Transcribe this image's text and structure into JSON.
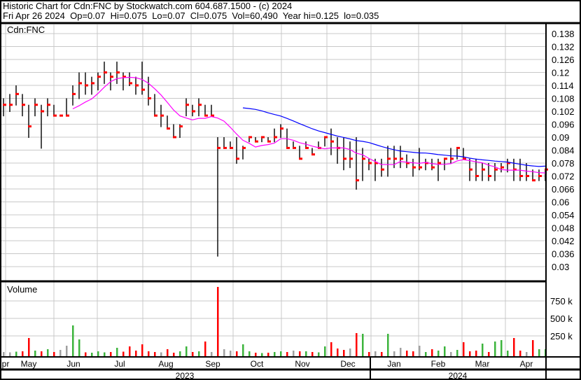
{
  "header": {
    "title": "Historic Chart for Cdn:FNC by Stockwatch.com 604.687.1500 - (c) 2024",
    "summary": "Fri Apr 26 2024  Op=0.07  Hi=0.075  Lo=0.07  Cl=0.075  Vol=60,490  Year hi=0.125  lo=0.035"
  },
  "colors": {
    "up": "#3cb43c",
    "down": "#ff0000",
    "flat": "#a0a0a0",
    "ma_short": "#ff00ff",
    "ma_long": "#0000ff",
    "tick": "#ff0000",
    "grid": "#c8c8c8"
  },
  "chart_data": {
    "type": "line",
    "title": "Cdn:FNC",
    "price_ticks": [
      "0.138",
      "0.132",
      "0.126",
      "0.12",
      "0.114",
      "0.108",
      "0.102",
      "0.096",
      "0.09",
      "0.084",
      "0.078",
      "0.072",
      "0.066",
      "0.06",
      "0.054",
      "0.048",
      "0.042",
      "0.036",
      "0.03"
    ],
    "ylim": [
      0.027,
      0.141
    ],
    "volume": {
      "label": "Volume",
      "ticks": [
        "750 k",
        "500 k",
        "250 k"
      ],
      "tick_values": [
        750,
        500,
        250
      ],
      "ylim": [
        0,
        1000
      ]
    },
    "months": [
      "pr",
      "May",
      "Jun",
      "Jul",
      "Aug",
      "Sep",
      "Oct",
      "Nov",
      "Dec",
      "Jan",
      "Feb",
      "Mar",
      "Apr"
    ],
    "years": [
      "2023",
      "2024"
    ],
    "ma_periods": [
      7,
      30
    ],
    "ma_start": [
      11,
      38
    ],
    "bars": [
      [
        0.108,
        0.1,
        0.105,
        20
      ],
      [
        0.11,
        0.102,
        0.105,
        15
      ],
      [
        0.114,
        0.105,
        0.11,
        25
      ],
      [
        0.11,
        0.1,
        0.105,
        30
      ],
      [
        0.105,
        0.09,
        0.095,
        220
      ],
      [
        0.108,
        0.1,
        0.105,
        40
      ],
      [
        0.105,
        0.085,
        0.102,
        30
      ],
      [
        0.108,
        0.1,
        0.105,
        60
      ],
      [
        0.105,
        0.1,
        0.1,
        20
      ],
      [
        0.1,
        0.1,
        0.1,
        50
      ],
      [
        0.108,
        0.1,
        0.1,
        110
      ],
      [
        0.114,
        0.105,
        0.11,
        400
      ],
      [
        0.12,
        0.108,
        0.115,
        200
      ],
      [
        0.12,
        0.11,
        0.114,
        15
      ],
      [
        0.118,
        0.11,
        0.115,
        10
      ],
      [
        0.12,
        0.112,
        0.118,
        30
      ],
      [
        0.125,
        0.115,
        0.12,
        15
      ],
      [
        0.12,
        0.112,
        0.118,
        20
      ],
      [
        0.125,
        0.115,
        0.12,
        80
      ],
      [
        0.12,
        0.112,
        0.118,
        25
      ],
      [
        0.12,
        0.114,
        0.115,
        100
      ],
      [
        0.118,
        0.11,
        0.114,
        40
      ],
      [
        0.125,
        0.11,
        0.112,
        130
      ],
      [
        0.118,
        0.105,
        0.108,
        30
      ],
      [
        0.11,
        0.1,
        0.1,
        20
      ],
      [
        0.105,
        0.095,
        0.1,
        15
      ],
      [
        0.1,
        0.094,
        0.094,
        60
      ],
      [
        0.096,
        0.09,
        0.09,
        10
      ],
      [
        0.096,
        0.09,
        0.095,
        30
      ],
      [
        0.108,
        0.1,
        0.105,
        100
      ],
      [
        0.105,
        0.1,
        0.102,
        20
      ],
      [
        0.108,
        0.1,
        0.105,
        30
      ],
      [
        0.105,
        0.1,
        0.1,
        170
      ],
      [
        0.105,
        0.1,
        0.1,
        20
      ],
      [
        0.09,
        0.035,
        0.085,
        950
      ],
      [
        0.09,
        0.085,
        0.085,
        60
      ],
      [
        0.088,
        0.085,
        0.085,
        40
      ],
      [
        0.09,
        0.078,
        0.08,
        30
      ],
      [
        0.086,
        0.08,
        0.085,
        130
      ],
      [
        0.09,
        0.088,
        0.09,
        30
      ],
      [
        0.09,
        0.088,
        0.088,
        10
      ],
      [
        0.09,
        0.088,
        0.09,
        5
      ],
      [
        0.09,
        0.088,
        0.088,
        10
      ],
      [
        0.094,
        0.088,
        0.09,
        20
      ],
      [
        0.096,
        0.09,
        0.094,
        30
      ],
      [
        0.094,
        0.085,
        0.085,
        20
      ],
      [
        0.088,
        0.085,
        0.085,
        40
      ],
      [
        0.086,
        0.08,
        0.08,
        30
      ],
      [
        0.088,
        0.085,
        0.085,
        30
      ],
      [
        0.085,
        0.082,
        0.082,
        20
      ],
      [
        0.088,
        0.085,
        0.085,
        15
      ],
      [
        0.09,
        0.086,
        0.09,
        100
      ],
      [
        0.094,
        0.082,
        0.088,
        160
      ],
      [
        0.09,
        0.078,
        0.085,
        70
      ],
      [
        0.09,
        0.075,
        0.08,
        50
      ],
      [
        0.088,
        0.076,
        0.08,
        70
      ],
      [
        0.09,
        0.066,
        0.07,
        290
      ],
      [
        0.085,
        0.07,
        0.08,
        280
      ],
      [
        0.08,
        0.075,
        0.078,
        20
      ],
      [
        0.08,
        0.07,
        0.078,
        30
      ],
      [
        0.08,
        0.072,
        0.075,
        20
      ],
      [
        0.086,
        0.072,
        0.08,
        280
      ],
      [
        0.086,
        0.076,
        0.08,
        30
      ],
      [
        0.086,
        0.076,
        0.08,
        80
      ],
      [
        0.082,
        0.076,
        0.078,
        40
      ],
      [
        0.08,
        0.072,
        0.076,
        30
      ],
      [
        0.085,
        0.075,
        0.076,
        110
      ],
      [
        0.08,
        0.075,
        0.078,
        20
      ],
      [
        0.08,
        0.075,
        0.076,
        60
      ],
      [
        0.08,
        0.07,
        0.078,
        40
      ],
      [
        0.08,
        0.075,
        0.08,
        100
      ],
      [
        0.085,
        0.078,
        0.08,
        20
      ],
      [
        0.085,
        0.08,
        0.085,
        50
      ],
      [
        0.085,
        0.08,
        0.08,
        160
      ],
      [
        0.08,
        0.07,
        0.075,
        30
      ],
      [
        0.08,
        0.07,
        0.072,
        40
      ],
      [
        0.078,
        0.07,
        0.075,
        140
      ],
      [
        0.078,
        0.07,
        0.072,
        20
      ],
      [
        0.078,
        0.07,
        0.075,
        170
      ],
      [
        0.078,
        0.074,
        0.076,
        190
      ],
      [
        0.08,
        0.074,
        0.078,
        40
      ],
      [
        0.08,
        0.07,
        0.075,
        220
      ],
      [
        0.08,
        0.07,
        0.072,
        40
      ],
      [
        0.078,
        0.07,
        0.072,
        20
      ],
      [
        0.075,
        0.07,
        0.07,
        190
      ],
      [
        0.075,
        0.07,
        0.072,
        60
      ],
      [
        0.075,
        0.07,
        0.075,
        60
      ]
    ]
  }
}
